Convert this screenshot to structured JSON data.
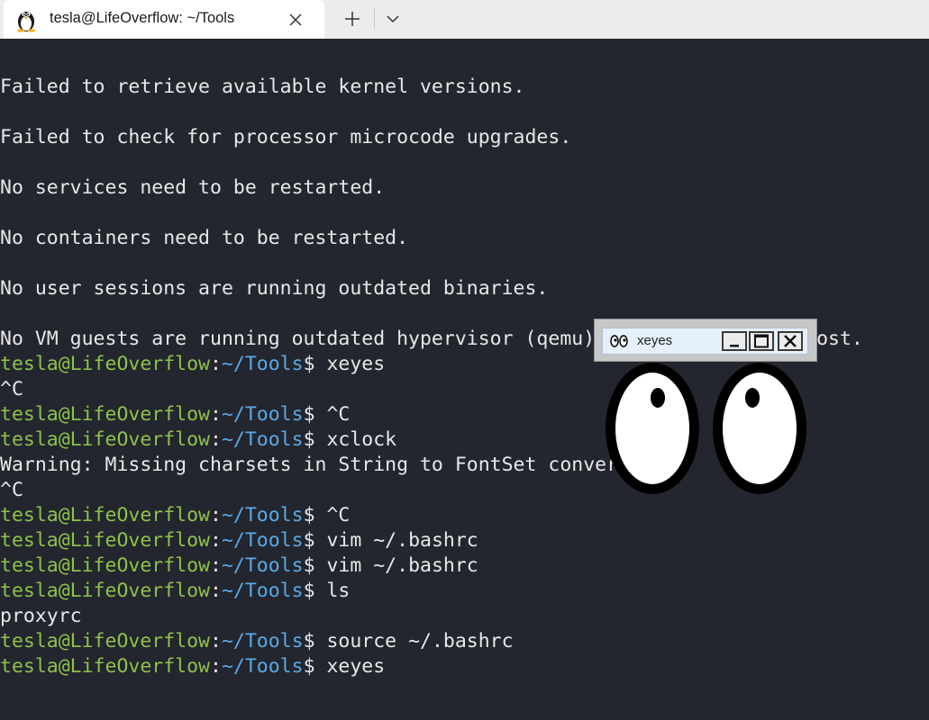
{
  "tab": {
    "title": "tesla@LifeOverflow: ~/Tools",
    "icon": "linux-penguin-icon"
  },
  "prompt": {
    "user": "tesla@LifeOverflow",
    "sep": ":",
    "path": "~/Tools",
    "symbol": "$"
  },
  "terminal_lines": [
    {
      "text": "Failed to retrieve available kernel versions."
    },
    {
      "text": "Failed to check for processor microcode upgrades."
    },
    {
      "text": "No services need to be restarted."
    },
    {
      "text": "No containers need to be restarted."
    },
    {
      "text": "No user sessions are running outdated binaries."
    },
    {
      "text": "No VM guests are running outdated hypervisor (qemu) binaries on this host."
    },
    {
      "cmd": " xeyes"
    },
    {
      "text": "^C"
    },
    {
      "cmd": " ^C"
    },
    {
      "cmd": " xclock"
    },
    {
      "text": "Warning: Missing charsets in String to FontSet conversion"
    },
    {
      "text": "^C"
    },
    {
      "cmd": " ^C"
    },
    {
      "cmd": " vim ~/.bashrc"
    },
    {
      "cmd": " vim ~/.bashrc"
    },
    {
      "cmd": " ls"
    },
    {
      "text": "proxyrc"
    },
    {
      "cmd": " source ~/.bashrc"
    },
    {
      "cmd": " xeyes"
    }
  ],
  "xeyes": {
    "title": "xeyes",
    "minimize_icon": "minimize-icon",
    "maximize_icon": "maximize-icon",
    "close_icon": "close-icon"
  },
  "colors": {
    "background": "#23262e",
    "text": "#e8e8e8",
    "user": "#8ec14a",
    "path": "#5aa9e6"
  }
}
